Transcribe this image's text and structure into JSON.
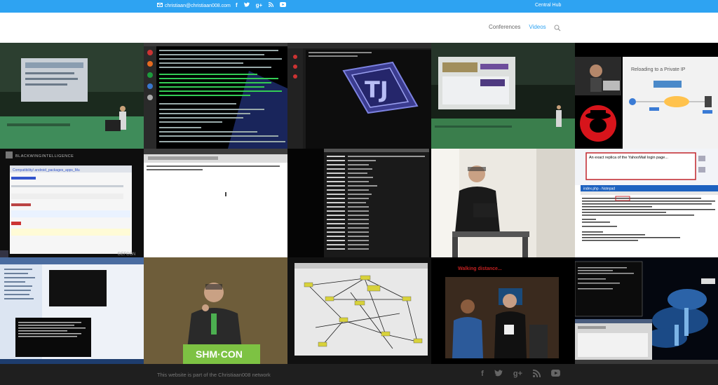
{
  "topbar": {
    "email": "christiaan@christiaan008.com",
    "social": [
      "f",
      "t",
      "g+",
      "rss",
      "yt"
    ],
    "hub_link": "Central Hub"
  },
  "nav": {
    "items": [
      "Conferences",
      "Videos"
    ],
    "active": "Videos"
  },
  "tiles": {
    "t13_caption": "Walking distance...",
    "t5_caption": "Reloading to a Private IP",
    "t10_caption": "An exact replica of the YahooMail login page...",
    "t10_editor_title": "index.php - Notepad",
    "t6_logo": "BLACKWINGINTELLIGENCE",
    "t12_banner": "SHM·CON",
    "t6_footer": "DEFCON"
  },
  "footer": {
    "note": "This website is part of the Christiaan008 network",
    "social": [
      "f",
      "t",
      "g+",
      "rss",
      "yt"
    ]
  }
}
